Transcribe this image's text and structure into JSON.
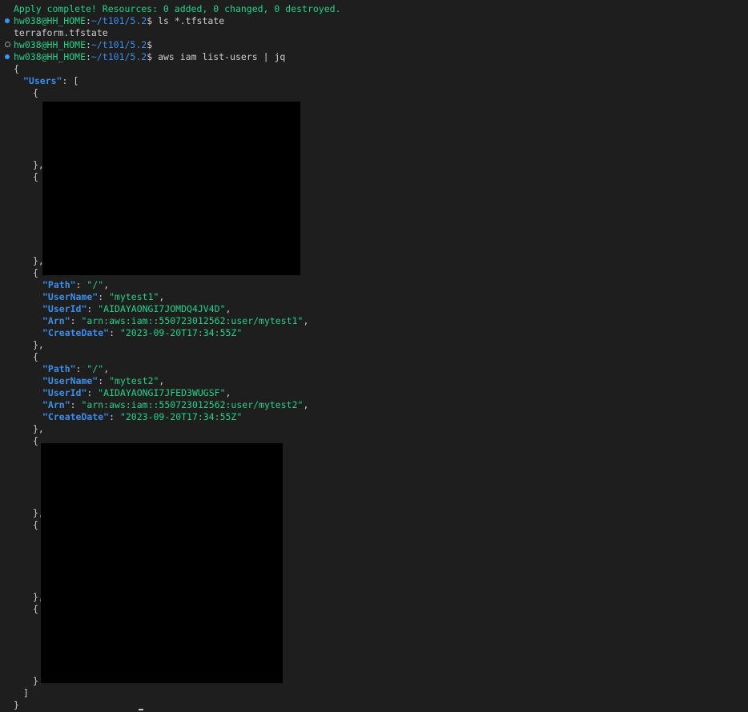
{
  "terminal": {
    "apply_message": "Apply complete! Resources: 0 added, 0 changed, 0 destroyed.",
    "prompt": {
      "user_host": "hw038@HH_HOME",
      "separator": ":",
      "path": "~/t101/5.2",
      "symbol": "$"
    },
    "cmd1": " ls *.tfstate",
    "cmd1_output": "terraform.tfstate",
    "cmd2": "",
    "cmd3": " aws iam list-users | jq"
  },
  "json": {
    "open_brace": "{",
    "users_key": "\"Users\"",
    "users_colon": ": [",
    "obj_open": "{",
    "obj_close_comma": "},",
    "obj_close": "}",
    "array_close": "]",
    "root_close": "}",
    "user1": {
      "path_key": "\"Path\"",
      "path_val": "\"/\"",
      "username_key": "\"UserName\"",
      "username_val": "\"mytest1\"",
      "userid_key": "\"UserId\"",
      "userid_val": "\"AIDAYAONGI7JOMDQ4JV4D\"",
      "arn_key": "\"Arn\"",
      "arn_val": "\"arn:aws:iam::550723012562:user/mytest1\"",
      "createdate_key": "\"CreateDate\"",
      "createdate_val": "\"2023-09-20T17:34:55Z\""
    },
    "user2": {
      "path_key": "\"Path\"",
      "path_val": "\"/\"",
      "username_key": "\"UserName\"",
      "username_val": "\"mytest2\"",
      "userid_key": "\"UserId\"",
      "userid_val": "\"AIDAYAONGI7JFED3WUGSF\"",
      "arn_key": "\"Arn\"",
      "arn_val": "\"arn:aws:iam::550723012562:user/mytest2\"",
      "createdate_key": "\"CreateDate\"",
      "createdate_val": "\"2023-09-20T17:34:55Z\""
    }
  },
  "colors": {
    "background": "#1e1e1e",
    "green": "#23d18b",
    "blue": "#3b8eea",
    "decoration": "#3794ff"
  }
}
